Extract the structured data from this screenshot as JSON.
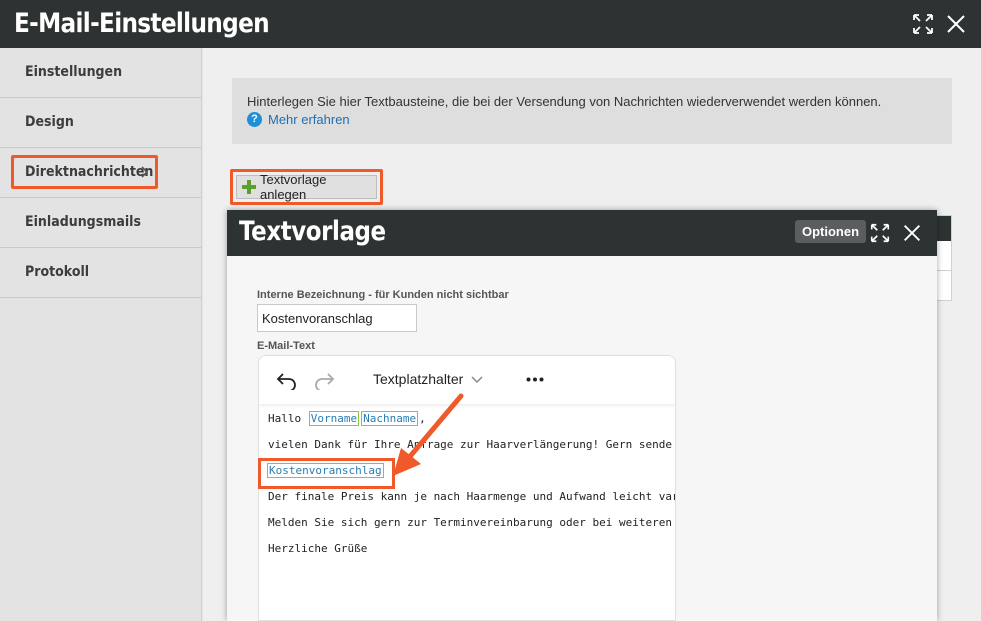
{
  "window": {
    "title": "E-Mail-Einstellungen"
  },
  "sidebar": {
    "items": [
      {
        "label": "Einstellungen"
      },
      {
        "label": "Design"
      },
      {
        "label": "Direktnachrichten"
      },
      {
        "label": "Einladungsmails"
      },
      {
        "label": "Protokoll"
      }
    ],
    "active_index": 2
  },
  "info": {
    "text": "Hinterlegen Sie hier Textbausteine, die bei der Versendung von Nachrichten wiederverwendet werden können.",
    "link": "Mehr erfahren"
  },
  "add_button": {
    "label": "Textvorlage anlegen"
  },
  "modal": {
    "title": "Textvorlage",
    "options_label": "Optionen",
    "name_label": "Interne Bezeichnung - für Kunden nicht sichtbar",
    "name_value": "Kostenvoranschlag",
    "text_label": "E-Mail-Text",
    "toolbar": {
      "placeholder_menu": "Textplatzhalter"
    },
    "editor": {
      "line1_prefix": "Hallo",
      "line1_ph1": "Vorname",
      "line1_ph2": "Nachname",
      "line1_suffix": ",",
      "line2": "vielen Dank für Ihre Anfrage zur Haarverlängerung! Gern sende",
      "line3_ph": "Kostenvoranschlag",
      "line4": "Der finale Preis kann je nach Haarmenge und Aufwand leicht var",
      "line5": "Melden Sie sich gern zur Terminvereinbarung oder bei weiteren",
      "line6": "Herzliche Grüße"
    }
  },
  "colors": {
    "highlight": "#f05a2a",
    "titlebar": "#2d3232",
    "link": "#1f6fb2",
    "placeholder_border": "#8cc63e"
  }
}
